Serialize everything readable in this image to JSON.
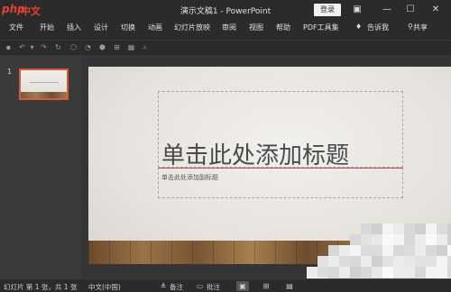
{
  "titlebar": {
    "logo_php": "php",
    "logo_zh": "中文网",
    "title": "演示文稿1 - PowerPoint",
    "login": "登录",
    "icons": [
      "ribbon-display-icon",
      "minimize-icon",
      "maximize-icon",
      "close-icon"
    ]
  },
  "ribbon": {
    "tabs": [
      "文件",
      "开始",
      "插入",
      "设计",
      "切换",
      "动画",
      "幻灯片放映",
      "审阅",
      "视图",
      "帮助",
      "PDF工具集",
      "告诉我"
    ],
    "share": "共享"
  },
  "qat": {
    "icons": [
      "save-icon",
      "undo-icon",
      "redo-icon",
      "repeat-icon",
      "shape-icon",
      "format-icon",
      "layout-icon",
      "arrange-icon",
      "customize-icon"
    ]
  },
  "thumbnails": [
    {
      "number": "1"
    }
  ],
  "slide": {
    "title_placeholder": "单击此处添加标题",
    "subtitle_placeholder": "单击此处添加副标题"
  },
  "statusbar": {
    "slide_info": "幻灯片 第 1 张，共 1 张",
    "language": "中文(中国)",
    "notes": "备注",
    "comments": "批注"
  },
  "colors": {
    "accent": "#d25a3e",
    "background": "#2b2b2b",
    "divider": "#b8475b"
  }
}
